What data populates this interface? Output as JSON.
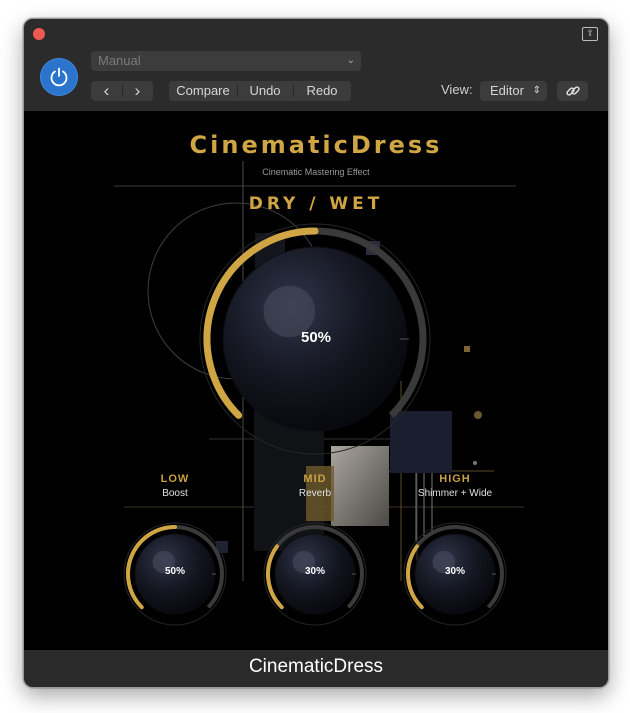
{
  "window": {
    "footer_title": "CinematicDress"
  },
  "toolbar": {
    "preset": "Manual",
    "prev": "‹",
    "next": "›",
    "compare": "Compare",
    "undo": "Undo",
    "redo": "Redo",
    "view_label": "View:",
    "view_value": "Editor"
  },
  "plugin": {
    "title": "CinematicDress",
    "subtitle": "Cinematic Mastering Effect",
    "main_knob": {
      "label": "DRY / WET",
      "value": "50%",
      "level": 0.5
    },
    "bands": [
      {
        "name": "LOW",
        "sub": "Boost",
        "value": "50%",
        "level": 0.5
      },
      {
        "name": "MID",
        "sub": "Reverb",
        "value": "30%",
        "level": 0.3
      },
      {
        "name": "HIGH",
        "sub": "Shimmer + Wide",
        "value": "30%",
        "level": 0.3
      }
    ]
  },
  "colors": {
    "accent_gold": "#d0a544",
    "power_blue": "#2a74cc",
    "close_red": "#ee5a52"
  }
}
